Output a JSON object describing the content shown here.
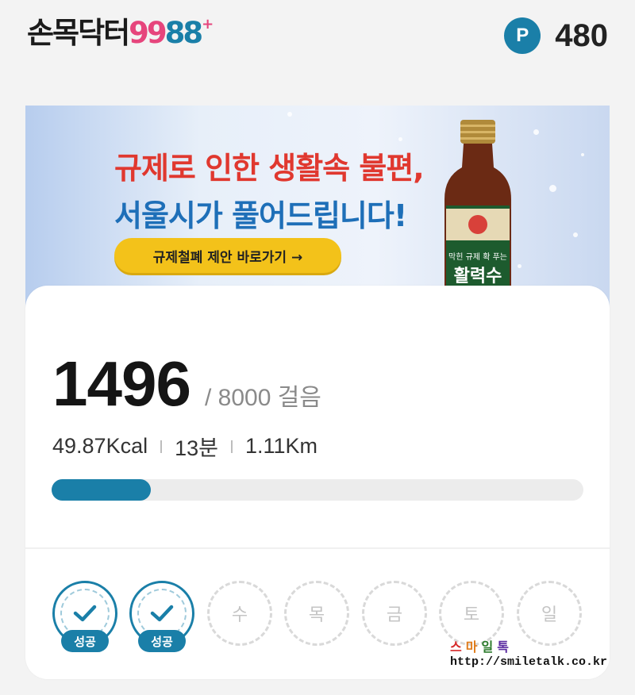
{
  "header": {
    "logo_korean": "손목닥터",
    "logo_num_a": "99",
    "logo_num_b": "88",
    "logo_plus": "+",
    "points_badge": "P",
    "points_value": "480"
  },
  "banner": {
    "line1": "규제로 인한 생활속 불편,",
    "line2": "서울시가 풀어드립니다!",
    "cta_label": "규제철폐 제안 바로가기 →",
    "bottle_small_text": "막힌 규제 확 푸는",
    "bottle_big_text": "활력수"
  },
  "steps": {
    "current": "1496",
    "goal": "/ 8000 걸음",
    "progress_fraction": 0.187
  },
  "stats": {
    "kcal": "49.87Kcal",
    "minutes": "13분",
    "distance": "1.11Km"
  },
  "week": [
    {
      "label": "성공",
      "status": "success"
    },
    {
      "label": "성공",
      "status": "success"
    },
    {
      "label": "수",
      "status": "pending"
    },
    {
      "label": "목",
      "status": "pending"
    },
    {
      "label": "금",
      "status": "pending"
    },
    {
      "label": "토",
      "status": "pending"
    },
    {
      "label": "일",
      "status": "pending"
    }
  ],
  "watermark": {
    "title": "스마일톡",
    "url": "http://smiletalk.co.kr"
  },
  "colors": {
    "accent": "#1a7fa8",
    "logo_pink": "#e6457c",
    "cta_yellow": "#f3c21a",
    "banner_red": "#e0382f",
    "banner_blue": "#1e6fb8"
  }
}
